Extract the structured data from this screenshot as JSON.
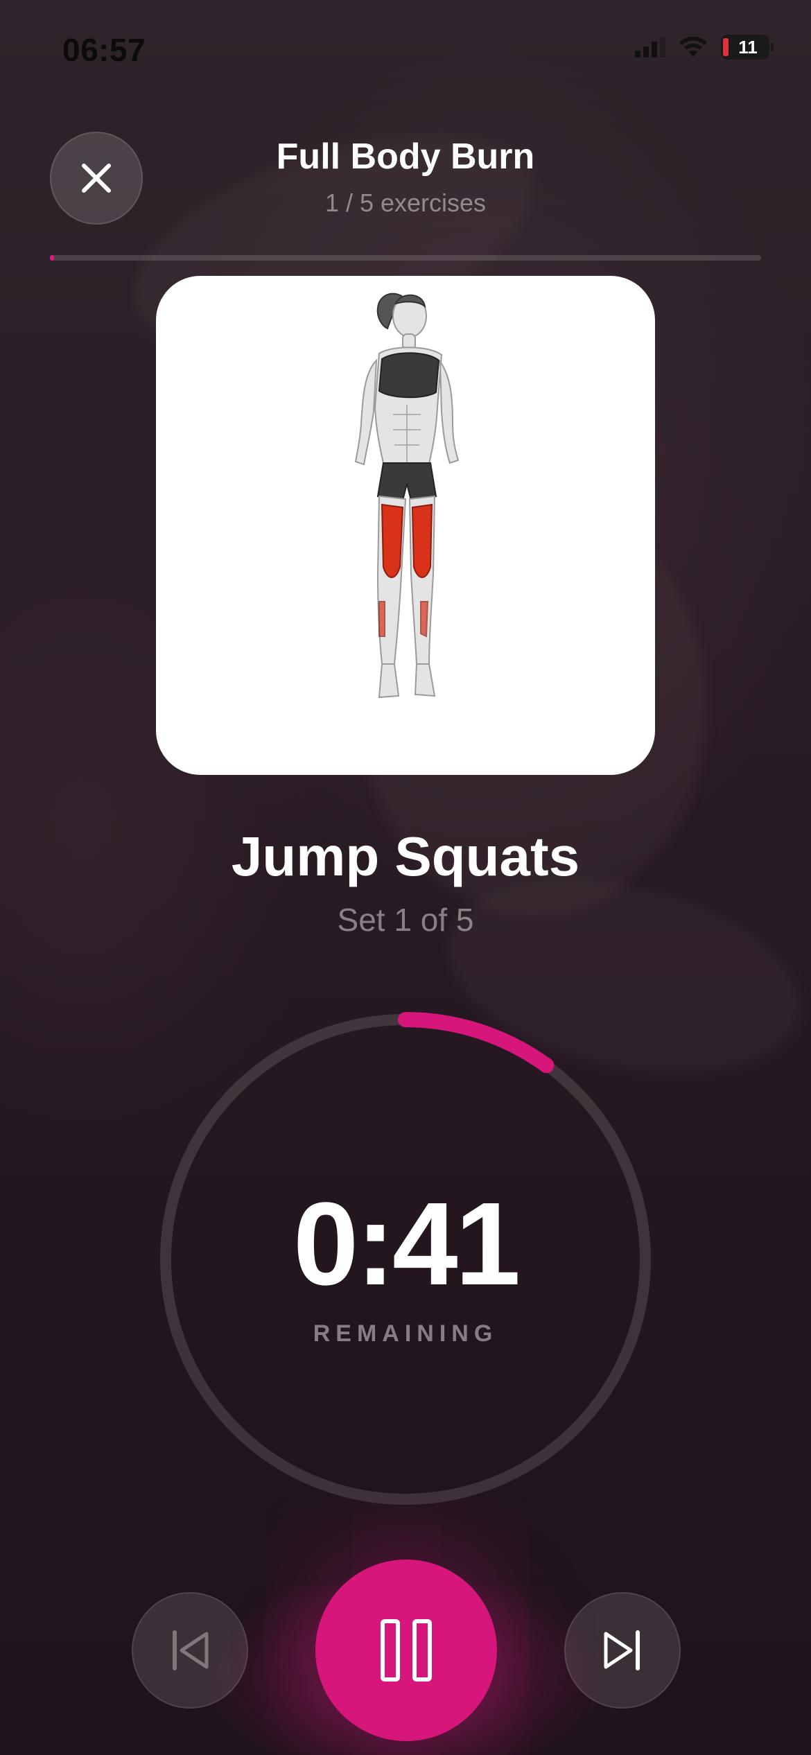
{
  "status_bar": {
    "time": "06:57",
    "battery_level": "11",
    "battery_color": "#e0313d"
  },
  "header": {
    "title": "Full Body Burn",
    "subtitle": "1 / 5 exercises",
    "close_icon": "close-icon",
    "progress_fraction": 0.0
  },
  "exercise": {
    "image": "exercise-illustration",
    "highlight_color": "#d8321a",
    "name": "Jump Squats",
    "set_label": "Set 1 of 5"
  },
  "timer": {
    "value": "0:41",
    "caption": "REMAINING",
    "elapsed_fraction": 0.1,
    "ring_color": "#d6167a"
  },
  "controls": {
    "previous_icon": "skip-previous-icon",
    "pause_icon": "pause-icon",
    "next_icon": "skip-next-icon",
    "accent_color": "#d6167a"
  }
}
